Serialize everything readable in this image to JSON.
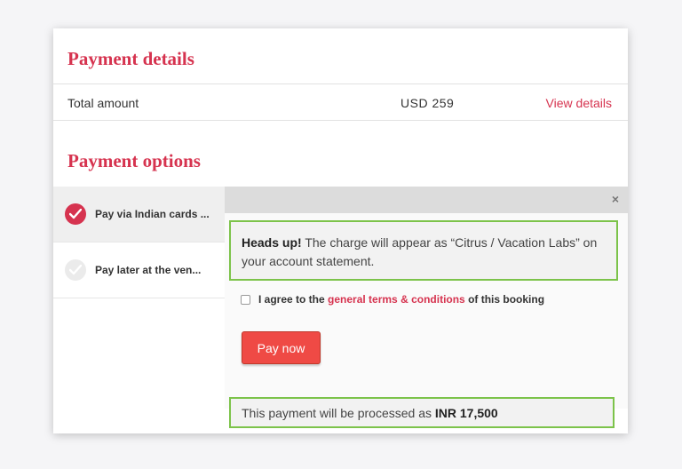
{
  "payment_details": {
    "title": "Payment details",
    "total_label": "Total amount",
    "total_value": "USD 259",
    "view_details_label": "View details"
  },
  "payment_options": {
    "title": "Payment options",
    "options": [
      {
        "label": "Pay via Indian cards ...",
        "selected": true
      },
      {
        "label": "Pay later at the ven...",
        "selected": false
      }
    ]
  },
  "panel": {
    "close_label": "×",
    "notice": {
      "heading": "Heads up!",
      "text": " The charge will appear as “Citrus / Vacation Labs” on your account statement."
    },
    "agree": {
      "prefix": "I agree to the ",
      "link": "general terms & conditions",
      "suffix": " of this booking",
      "checked": false
    },
    "pay_button_label": "Pay now",
    "processed": {
      "prefix": "This payment will be processed as ",
      "amount": "INR 17,500"
    }
  },
  "colors": {
    "accent": "#d6334f",
    "button": "#ef4a45",
    "highlight_border": "#7cc34a"
  }
}
